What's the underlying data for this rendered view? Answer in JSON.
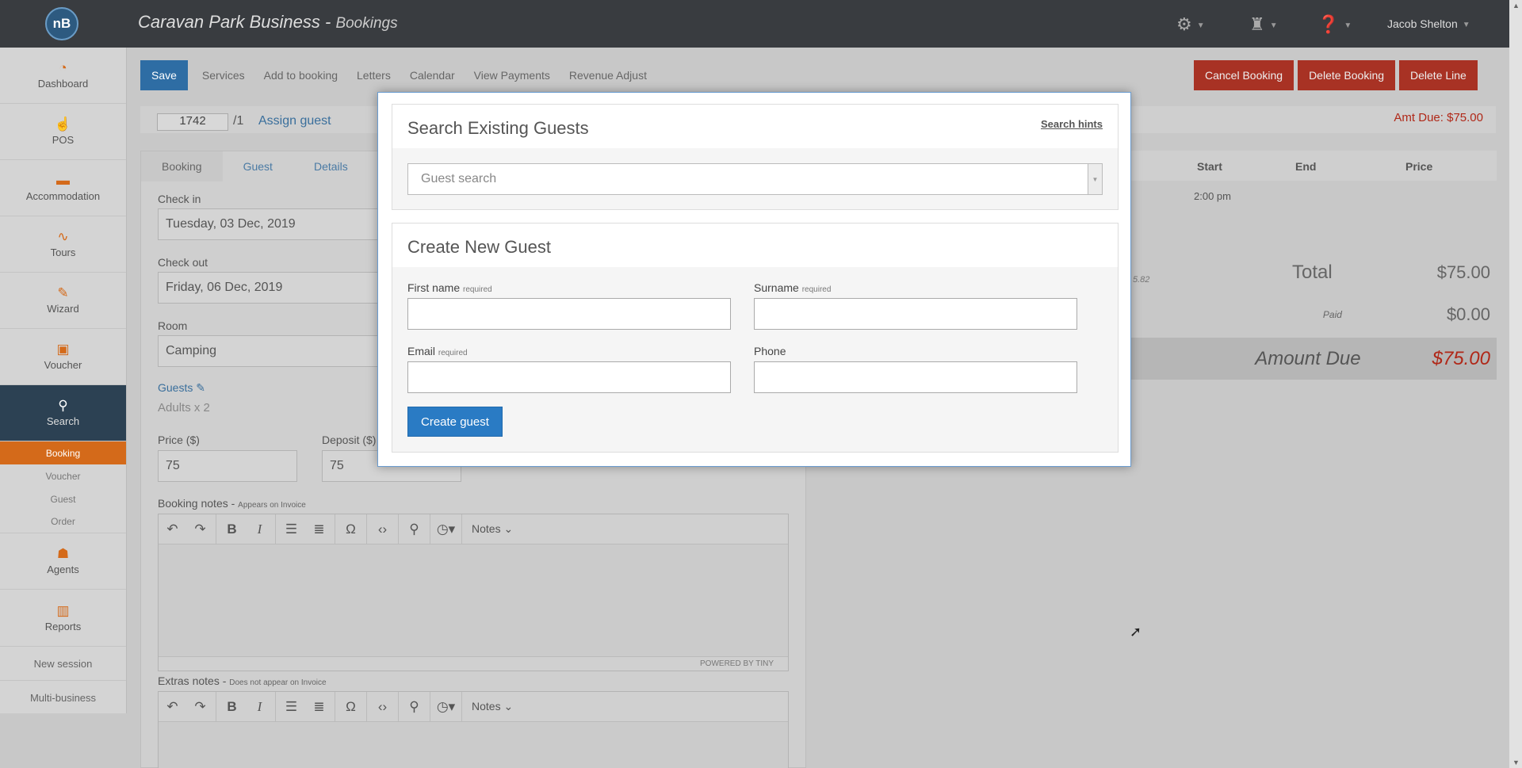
{
  "app": {
    "logo": "nB",
    "title": "Caravan Park Business - ",
    "subtitle": "Bookings",
    "user": "Jacob Shelton"
  },
  "sidebar": {
    "items": [
      {
        "label": "Dashboard",
        "icon": "dashboard-icon"
      },
      {
        "label": "POS",
        "icon": "hand-icon"
      },
      {
        "label": "Accommodation",
        "icon": "bed-icon"
      },
      {
        "label": "Tours",
        "icon": "route-icon"
      },
      {
        "label": "Wizard",
        "icon": "wand-icon"
      },
      {
        "label": "Voucher",
        "icon": "gift-icon"
      },
      {
        "label": "Search",
        "icon": "search-icon"
      }
    ],
    "subitems": [
      "Booking",
      "Voucher",
      "Guest",
      "Order"
    ],
    "items2": [
      {
        "label": "Agents",
        "icon": "user-icon"
      },
      {
        "label": "Reports",
        "icon": "bar-chart-icon"
      }
    ],
    "plain": [
      "New session",
      "Multi-business"
    ]
  },
  "toolbar": {
    "save": "Save",
    "buttons": [
      "Services",
      "Add to booking",
      "Letters",
      "Calendar",
      "View Payments",
      "Revenue Adjust"
    ],
    "danger": [
      "Cancel Booking",
      "Delete Booking",
      "Delete Line"
    ]
  },
  "booking": {
    "ref": "1742",
    "ref_suffix": "/1",
    "assign_guest": "Assign guest",
    "amt_due": "Amt Due: $75.00",
    "tabs": [
      "Booking",
      "Guest",
      "Details"
    ],
    "checkin_label": "Check in",
    "checkin": "Tuesday, 03 Dec, 2019",
    "checkout_label": "Check out",
    "checkout": "Friday, 06 Dec, 2019",
    "room_label": "Room",
    "room": "Camping",
    "guests_label": "Guests",
    "guests": "Adults x 2",
    "price_label": "Price ($)",
    "price": "75",
    "deposit_label": "Deposit ($)",
    "deposit": "75",
    "booking_notes_label": "Booking notes - ",
    "booking_notes_hint": "Appears on Invoice",
    "extras_notes_label": "Extras notes - ",
    "extras_notes_hint": "Does not appear on Invoice",
    "editor_notes": "Notes",
    "powered": "POWERED BY TINY"
  },
  "summary": {
    "headers": [
      "Start",
      "End",
      "Price"
    ],
    "start_time": "2:00 pm",
    "fragment": "5.82",
    "total_label": "Total",
    "total": "$75.00",
    "paid_label": "Paid",
    "paid": "$0.00",
    "due_label": "Amount Due",
    "due": "$75.00"
  },
  "modal": {
    "close": "×",
    "search_title": "Search Existing Guests",
    "search_hints": "Search hints",
    "search_placeholder": "Guest search",
    "create_title": "Create New Guest",
    "first_name": "First name",
    "surname": "Surname",
    "email": "Email",
    "phone": "Phone",
    "required": "required",
    "create_button": "Create guest"
  }
}
